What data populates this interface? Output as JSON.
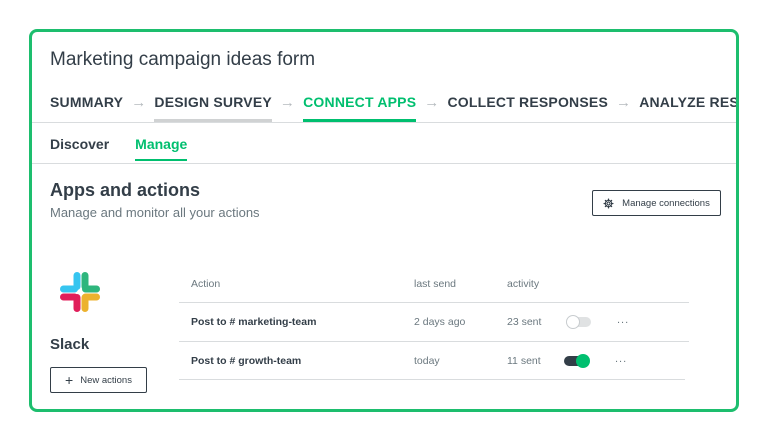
{
  "form": {
    "title": "Marketing campaign ideas form"
  },
  "steps": [
    {
      "label": "SUMMARY",
      "state": "default"
    },
    {
      "label": "DESIGN SURVEY",
      "state": "visited"
    },
    {
      "label": "CONNECT APPS",
      "state": "active"
    },
    {
      "label": "COLLECT RESPONSES",
      "state": "default"
    },
    {
      "label": "ANALYZE RESULTS",
      "state": "default"
    }
  ],
  "step_separator": "→",
  "subtabs": [
    {
      "label": "Discover",
      "active": false
    },
    {
      "label": "Manage",
      "active": true
    }
  ],
  "section": {
    "title": "Apps and actions",
    "subtitle": "Manage and monitor all your actions"
  },
  "manage_connections": {
    "label": "Manage connections",
    "icon": "gear-icon"
  },
  "app": {
    "name": "Slack",
    "logo": "slack-logo",
    "new_actions_label": "New actions",
    "new_actions_icon": "plus-icon"
  },
  "table": {
    "headers": {
      "action": "Action",
      "last_send": "last send",
      "activity": "activity"
    },
    "rows": [
      {
        "action": "Post to # marketing-team",
        "last_send": "2 days ago",
        "activity": "23 sent",
        "enabled": false,
        "more": "..."
      },
      {
        "action": "Post to # growth-team",
        "last_send": "today",
        "activity": "11 sent",
        "enabled": true,
        "more": "..."
      }
    ]
  },
  "colors": {
    "accent": "#00bf6f",
    "text": "#333e48",
    "muted": "#6b787f",
    "border": "#d9dcde"
  }
}
